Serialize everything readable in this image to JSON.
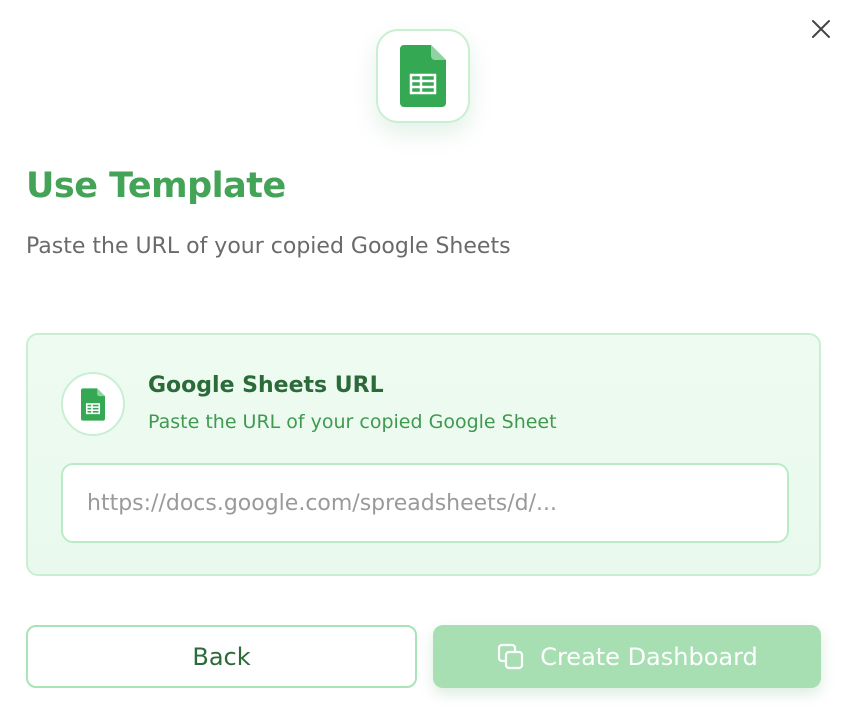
{
  "dialog": {
    "close_icon": "close-icon",
    "hero_icon": "google-sheets-icon",
    "title": "Use Template",
    "subtitle": "Paste the URL of your copied Google Sheets"
  },
  "url_card": {
    "icon": "google-sheets-icon",
    "title": "Google Sheets URL",
    "description": "Paste the URL of your copied Google Sheet",
    "input": {
      "value": "",
      "placeholder": "https://docs.google.com/spreadsheets/d/..."
    }
  },
  "actions": {
    "back_label": "Back",
    "create_label": "Create Dashboard",
    "create_icon": "copy-icon"
  },
  "colors": {
    "accent": "#43a356",
    "accent_dark": "#2c6a3a",
    "card_bg": "#eefbf1",
    "border": "#c9efd3",
    "button_disabled": "#a7dfb3"
  }
}
